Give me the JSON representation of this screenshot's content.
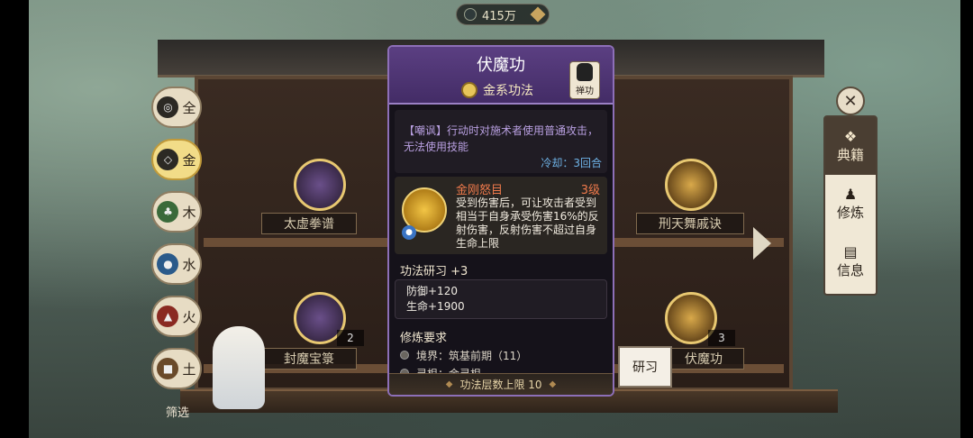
{
  "currency": {
    "amount": "415万"
  },
  "elements": [
    {
      "label": "全",
      "icon": "all-element-icon",
      "active": false
    },
    {
      "label": "金",
      "icon": "metal-element-icon",
      "active": true
    },
    {
      "label": "木",
      "icon": "wood-element-icon",
      "active": false
    },
    {
      "label": "水",
      "icon": "water-element-icon",
      "active": false
    },
    {
      "label": "火",
      "icon": "fire-element-icon",
      "active": false
    },
    {
      "label": "土",
      "icon": "earth-element-icon",
      "active": false
    }
  ],
  "shelf": {
    "books": [
      {
        "name": "太虚拳谱",
        "count": ""
      },
      {
        "name": "刑天舞戚诀",
        "count": ""
      },
      {
        "name": "封魔宝箓",
        "count": "2"
      },
      {
        "name": "伏魔功",
        "count": "3"
      }
    ]
  },
  "side_menu": [
    {
      "label": "典籍",
      "icon": "book-icon",
      "active": true
    },
    {
      "label": "修炼",
      "icon": "meditate-icon",
      "active": false
    },
    {
      "label": "信息",
      "icon": "info-icon",
      "active": false
    }
  ],
  "filter_label": "筛选",
  "study_button": "研习",
  "panel": {
    "title": "伏魔功",
    "element_tag": "金系功法",
    "type_badge": "禅功",
    "effect_text": "【嘲讽】行动时对施术者使用普通攻击，无法使用技能",
    "cooldown": "冷却：3回合",
    "skill": {
      "name": "金刚怒目",
      "level": "3级",
      "desc": "受到伤害后，可让攻击者受到相当于自身承受伤害16%的反射伤害，反射伤害不超过自身生命上限"
    },
    "research_title": "功法研习 +3",
    "stats": [
      "防御+120",
      "生命+1900"
    ],
    "requirements_title": "修炼要求",
    "requirements": [
      "境界：筑基前期（11）",
      "灵根：金灵根"
    ],
    "footer": "功法层数上限 10"
  }
}
